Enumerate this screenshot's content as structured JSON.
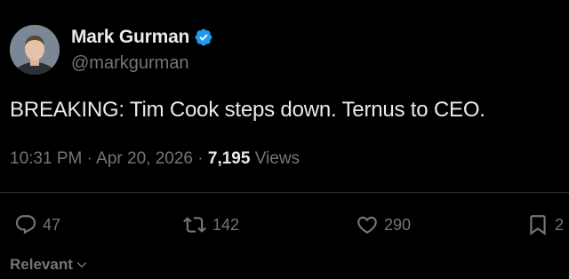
{
  "author": {
    "display_name": "Mark Gurman",
    "handle": "@markgurman",
    "verified": true
  },
  "tweet": {
    "text": "BREAKING: Tim Cook steps down. Ternus to CEO.",
    "time": "10:31 PM",
    "separator": "·",
    "date": "Apr 20, 2026",
    "views_count": "7,195",
    "views_label": "Views"
  },
  "actions": {
    "replies": "47",
    "reposts": "142",
    "likes": "290",
    "bookmarks": "2"
  },
  "sort": {
    "label": "Relevant"
  },
  "colors": {
    "background": "#000000",
    "text_primary": "#e7e9ea",
    "text_secondary": "#71767b",
    "verified_badge": "#1d9bf0",
    "divider": "#2f3336"
  },
  "icons": {
    "verified": "verified-badge-icon",
    "reply": "reply-icon",
    "repost": "repost-icon",
    "like": "heart-icon",
    "bookmark": "bookmark-icon",
    "sort": "chevron-down-icon"
  }
}
